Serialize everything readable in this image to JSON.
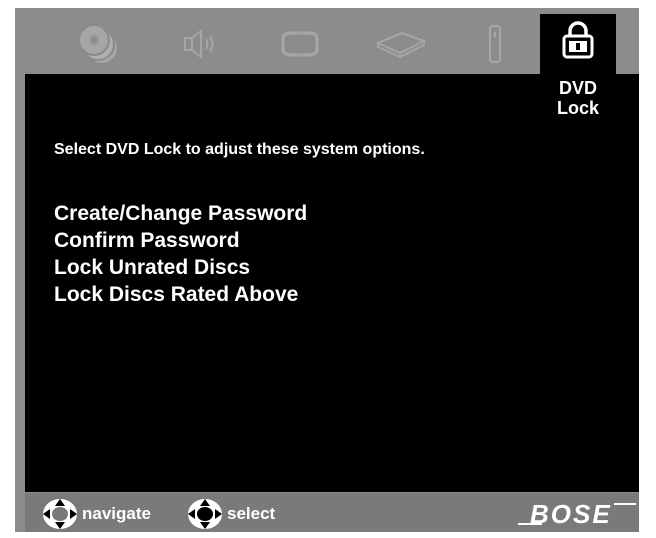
{
  "tabs": [
    {
      "icon": "disc-stack-icon",
      "active": false
    },
    {
      "icon": "speaker-icon",
      "active": false
    },
    {
      "icon": "screen-icon",
      "active": false
    },
    {
      "icon": "dvd-player-icon",
      "active": false
    },
    {
      "icon": "remote-control-icon",
      "active": false
    },
    {
      "icon": "padlock-icon",
      "active": true,
      "label_line1": "DVD",
      "label_line2": "Lock"
    }
  ],
  "instruction": "Select DVD Lock to adjust these system options.",
  "menu": [
    "Create/Change Password",
    "Confirm Password",
    "Lock Unrated Discs",
    "Lock Discs Rated Above"
  ],
  "footer": {
    "navigate_label": "navigate",
    "select_label": "select",
    "brand": "BOSE"
  },
  "colors": {
    "frame": "#8c8c8c",
    "inactive_icon": "#a6a6a6",
    "content_bg": "#000000",
    "text": "#ffffff",
    "footer_bg": "#7a7a7a"
  }
}
